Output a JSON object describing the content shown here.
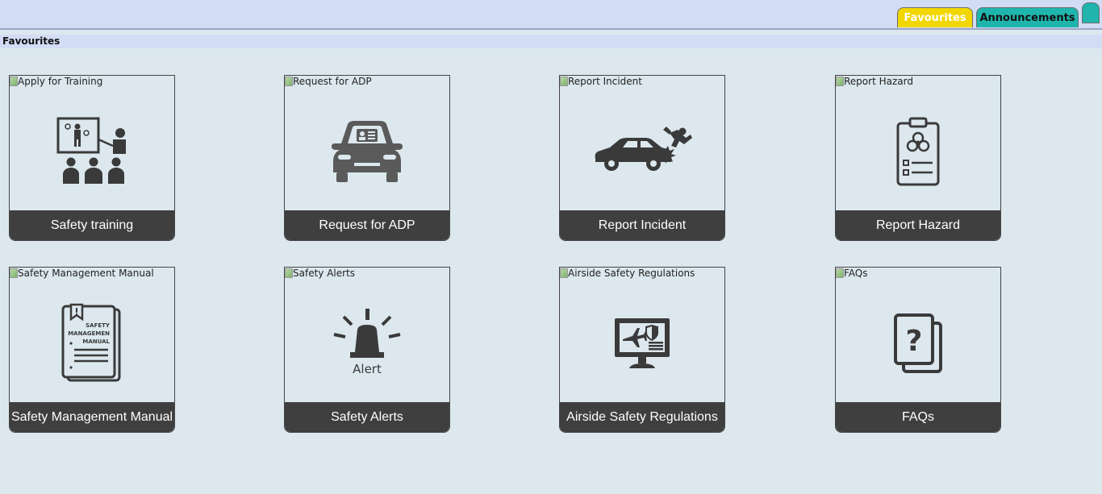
{
  "tabs": {
    "favourites": "Favourites",
    "announcements": "Announcements"
  },
  "section_title": "Favourites",
  "tiles": [
    {
      "alt": "Apply for Training",
      "label": "Safety training",
      "icon": "training-icon"
    },
    {
      "alt": "Request for ADP",
      "label": "Request for ADP",
      "icon": "car-id-icon"
    },
    {
      "alt": "Report Incident",
      "label": "Report Incident",
      "icon": "car-incident-icon"
    },
    {
      "alt": "Report Hazard",
      "label": "Report Hazard",
      "icon": "biohazard-clipboard-icon"
    },
    {
      "alt": "Safety Management Manual",
      "label": "Safety Management Manual",
      "icon": "manual-icon",
      "icon_text": [
        "SAFETY",
        "MANAGEMEN",
        "MANUAL"
      ]
    },
    {
      "alt": "Safety Alerts",
      "label": "Safety Alerts",
      "icon": "alert-siren-icon",
      "icon_text": "Alert"
    },
    {
      "alt": "Airside Safety Regulations",
      "label": "Airside Safety Regulations",
      "icon": "monitor-airplane-icon"
    },
    {
      "alt": "FAQs",
      "label": "FAQs",
      "icon": "faq-icon",
      "icon_text": "?"
    }
  ],
  "colors": {
    "page_bg": "#dce8ee",
    "topbar_bg": "#d3dcf5",
    "tab_favourites": "#f2d600",
    "tab_announcements": "#1fb5ad",
    "tile_label_bg": "#3f3f3f",
    "icon": "#3a3a3a"
  }
}
